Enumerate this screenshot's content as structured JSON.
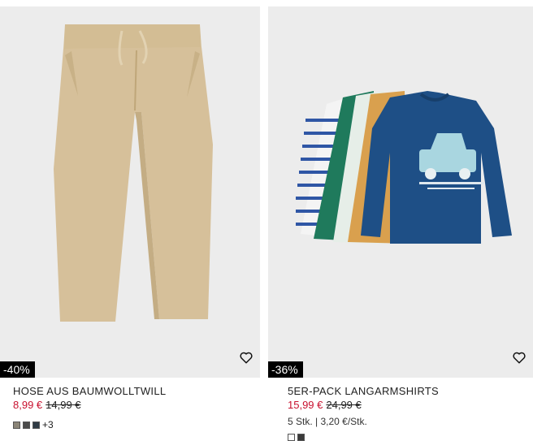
{
  "products": [
    {
      "badge": "-40%",
      "title": "HOSE AUS BAUMWOLLTWILL",
      "price_now": "8,99 €",
      "price_was": "14,99 €",
      "swatches": [
        "#8b8578",
        "#4b4b4b",
        "#2f3a44"
      ],
      "more_colors": "+3",
      "image_icon": "beige-pants-image"
    },
    {
      "badge": "-36%",
      "title": "5ER-PACK LANGARMSHIRTS",
      "price_now": "15,99 €",
      "price_was": "24,99 €",
      "details": "5 Stk. | 3,20 €/Stk.",
      "swatches": [
        "#ffffff",
        "#3b3b3b"
      ],
      "image_icon": "longsleeve-shirts-image"
    }
  ],
  "colors": {
    "sale": "#c8102e",
    "badge_bg": "#000000",
    "image_bg": "#ececec"
  }
}
